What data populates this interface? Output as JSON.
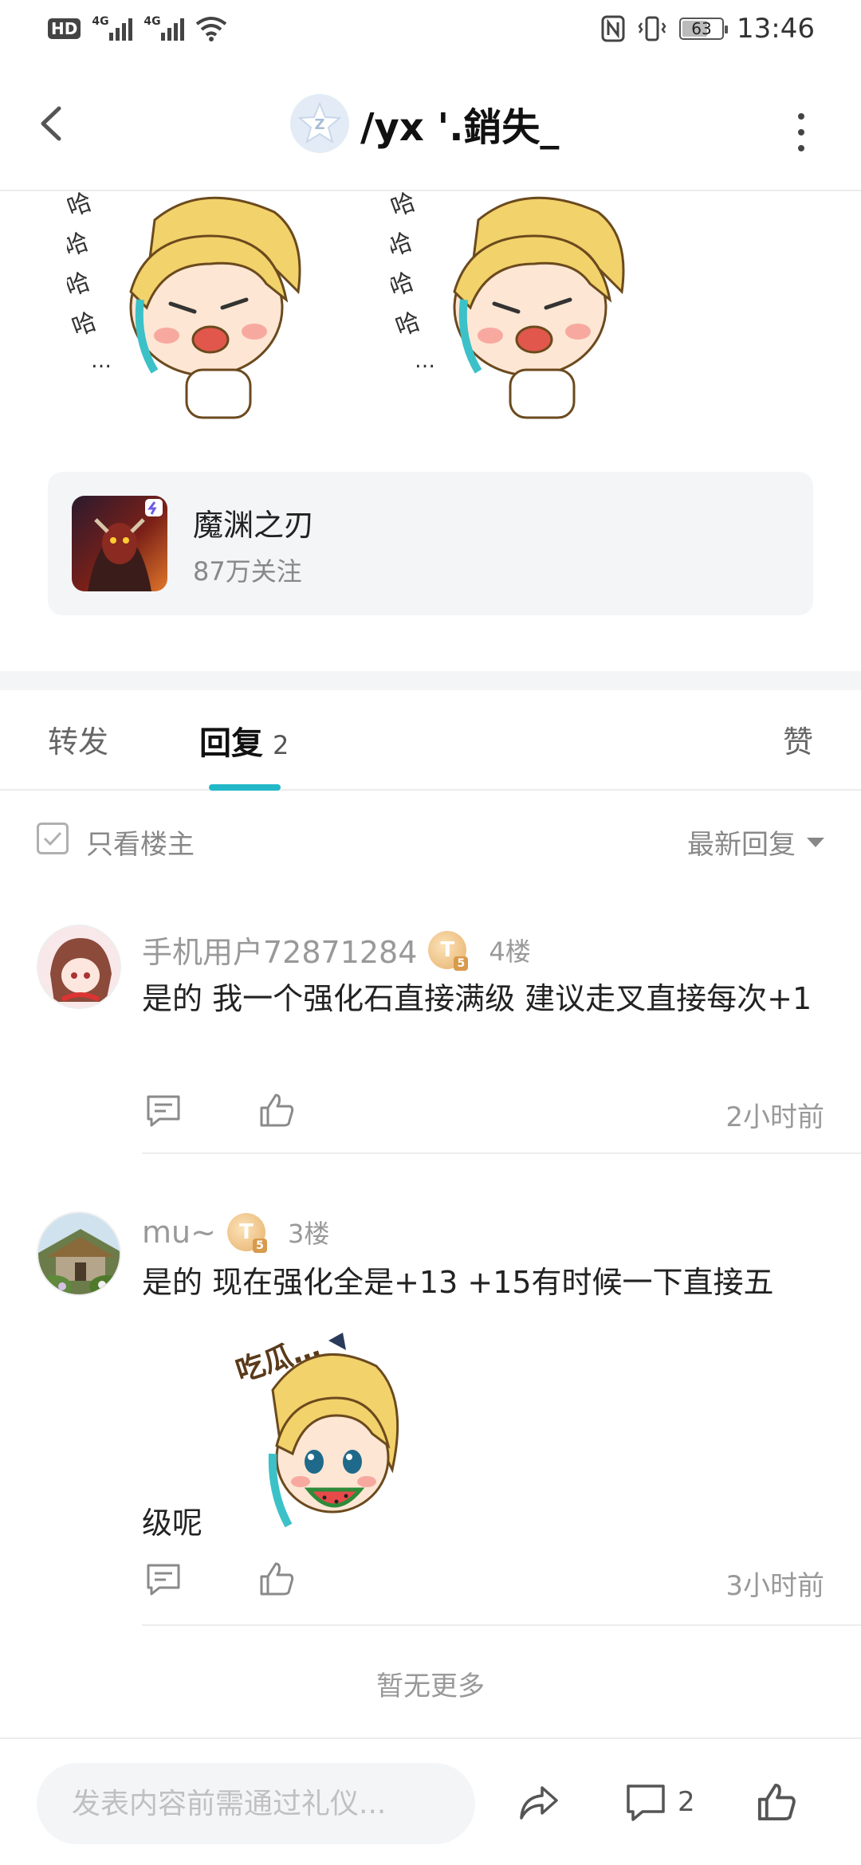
{
  "status_bar": {
    "hd": "HD",
    "net1": "4G",
    "net2": "4G",
    "battery": "63",
    "time": "13:46"
  },
  "header": {
    "title": "/yx '.銷失_"
  },
  "forum": {
    "name": "魔渊之刃",
    "followers": "87万关注"
  },
  "tabs": {
    "repost": "转发",
    "reply": "回复",
    "reply_count": "2",
    "like": "赞"
  },
  "filter": {
    "only_op": "只看楼主",
    "sort": "最新回复"
  },
  "replies": [
    {
      "username": "手机用户72871284",
      "level": "T",
      "level_sub": "5",
      "floor": "4楼",
      "text": "是的 我一个强化石直接满级   建议走叉直接每次+1",
      "time": "2小时前"
    },
    {
      "username": "mu~",
      "level": "T",
      "level_sub": "5",
      "floor": "3楼",
      "text_before": "是的 现在强化全是+13 +15有时候一下直接五",
      "text_after": "级呢",
      "time": "3小时前"
    }
  ],
  "sticker_text": {
    "laugh": "哈哈哈哈…",
    "eat": "吃瓜…"
  },
  "no_more": "暂无更多",
  "bottom": {
    "input_placeholder": "发表内容前需通过礼仪...",
    "comment_count": "2"
  },
  "colors": {
    "accent": "#22b8c8",
    "muted_text": "#999999",
    "card_bg": "#f4f5f7"
  }
}
